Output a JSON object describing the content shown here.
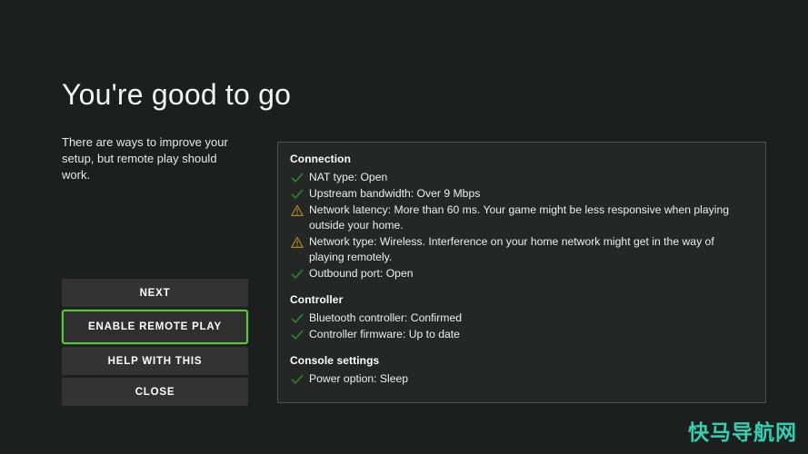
{
  "page": {
    "background_color": "#1d1e1e",
    "title": "You're good to go",
    "subtitle": "There are ways to improve your setup, but remote play should work."
  },
  "buttons": [
    {
      "label": "NEXT",
      "name": "next-button",
      "focused": false
    },
    {
      "label": "ENABLE REMOTE PLAY",
      "name": "enable-remote-play-button",
      "focused": true
    },
    {
      "label": "HELP WITH THIS",
      "name": "help-with-this-button",
      "focused": false
    },
    {
      "label": "CLOSE",
      "name": "close-button",
      "focused": false
    }
  ],
  "colors": {
    "focus_green": "#55c93a",
    "check_green": "#2c8a2c",
    "warning_amber": "#a88428",
    "button_fill": "#333333",
    "panel_fill": "#252626",
    "panel_border": "#4c4d4d",
    "watermark": "#35cfb2"
  },
  "panel": {
    "sections": [
      {
        "heading": "Connection",
        "items": [
          {
            "status": "ok",
            "text": "NAT type: Open"
          },
          {
            "status": "ok",
            "text": "Upstream bandwidth: Over 9 Mbps"
          },
          {
            "status": "warning",
            "text": "Network latency: More than 60 ms. Your game might be less responsive when playing outside your home."
          },
          {
            "status": "warning",
            "text": "Network type: Wireless. Interference on your home network might get in the way of playing remotely."
          },
          {
            "status": "ok",
            "text": "Outbound port: Open"
          }
        ]
      },
      {
        "heading": "Controller",
        "items": [
          {
            "status": "ok",
            "text": "Bluetooth controller: Confirmed"
          },
          {
            "status": "ok",
            "text": "Controller firmware: Up to date"
          }
        ]
      },
      {
        "heading": "Console settings",
        "items": [
          {
            "status": "ok",
            "text": "Power option: Sleep"
          }
        ]
      }
    ]
  },
  "watermark": {
    "text": "快马导航网"
  }
}
